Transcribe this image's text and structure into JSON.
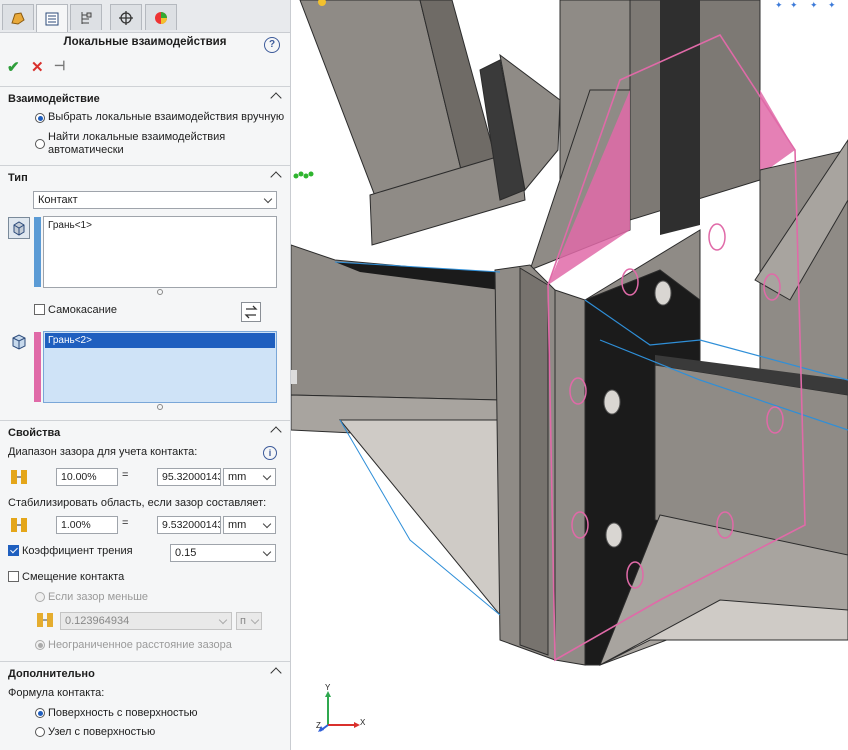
{
  "panel": {
    "tabs": [
      "feature-manager-icon",
      "property-manager-icon",
      "configuration-manager-icon",
      "dimxpert-icon",
      "display-manager-icon"
    ],
    "title": "Локальные взаимодействия",
    "help_label": "?",
    "actions": {
      "ok": "✔",
      "cancel": "✕",
      "pin": "⊣"
    }
  },
  "interaction": {
    "header": "Взаимодействие",
    "opt_manual": "Выбрать локальные взаимодействия вручную",
    "opt_auto_line1": "Найти локальные взаимодействия",
    "opt_auto_line2": "автоматически",
    "selected": "manual"
  },
  "type": {
    "header": "Тип",
    "value": "Контакт",
    "set1_item": "Грань<1>",
    "set1_color": "#5b9bd5",
    "self_contact_label": "Самокасание",
    "set2_item": "Грань<2>",
    "set2_color": "#e06aa8"
  },
  "properties": {
    "header": "Свойства",
    "gap_range_label": "Диапазон зазора для учета контакта:",
    "gap_percent": "10.00%",
    "equals": "=",
    "gap_value": "95.32000143",
    "gap_unit": "mm",
    "stabilize_label": "Стабилизировать область, если зазор составляет:",
    "stab_percent": "1.00%",
    "stab_value": "9.532000143",
    "stab_unit": "mm",
    "friction_label": "Коэффициент трения",
    "friction_value": "0.15",
    "friction_checked": true,
    "offset_label": "Смещение контакта",
    "offset_checked": false,
    "if_gap_less": "Если зазор меньше",
    "offset_value": "0.123964934",
    "offset_unit": "п",
    "unlimited_gap": "Неограниченное расстояние зазора"
  },
  "advanced": {
    "header": "Дополнительно",
    "formula_label": "Формула контакта:",
    "opt_surface": "Поверхность с поверхностью",
    "opt_node": "Узел с поверхностью",
    "selected": "surface"
  },
  "triad": {
    "x": "X",
    "y": "Y",
    "z": "Z"
  },
  "colors": {
    "accent": "#1f5fbf",
    "highlight_pink": "#e06aa8",
    "model_gray": "#8f8b86",
    "model_dark": "#1b1b1b",
    "edge_blue": "#2f8fd8"
  }
}
